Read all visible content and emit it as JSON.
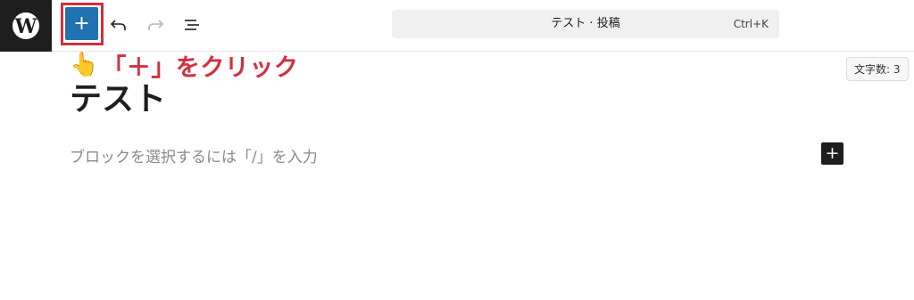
{
  "toolbar": {
    "logo_letter": "W",
    "inserter_glyph": "+",
    "undo_icon": "undo-icon",
    "redo_icon": "redo-icon",
    "document_overview_icon": "list-view-icon",
    "command_bar": {
      "title": "テスト · 投稿",
      "shortcut": "Ctrl+K"
    }
  },
  "annotation": {
    "hand_glyph": "👆",
    "text": "「＋」をクリック",
    "color": "#d32f3f"
  },
  "editor": {
    "word_count": "文字数: 3",
    "post_title": "テスト",
    "block_placeholder": "ブロックを選択するには「/」を入力",
    "block_add_glyph": "+"
  },
  "colors": {
    "accent": "#2271b1",
    "dark": "#1e1e1e",
    "highlight": "#d32f3f"
  }
}
